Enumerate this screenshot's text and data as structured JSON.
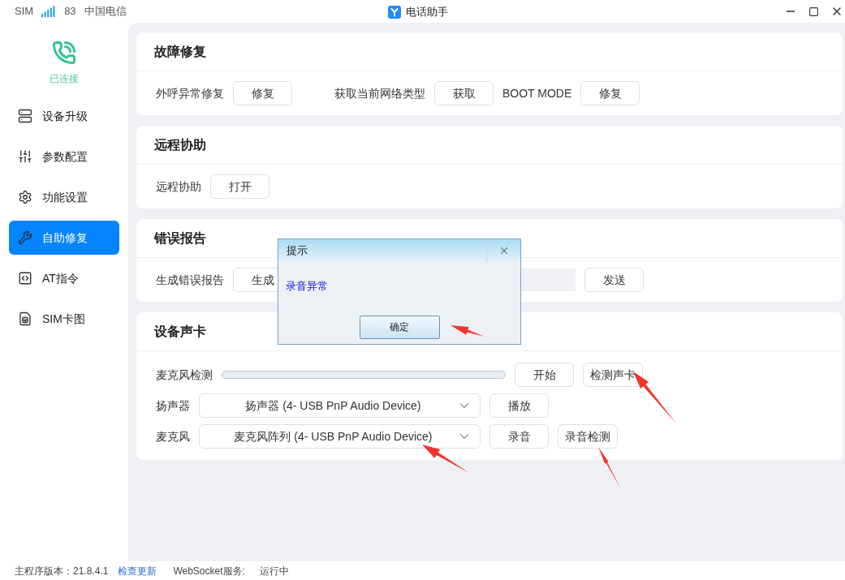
{
  "status": {
    "sim_label": "SIM",
    "signal_value": "83",
    "carrier": "中国电信"
  },
  "window": {
    "title": "电话助手"
  },
  "connection": {
    "label": "已连接"
  },
  "sidebar": {
    "items": [
      {
        "label": "设备升级",
        "selected": false
      },
      {
        "label": "参数配置",
        "selected": false
      },
      {
        "label": "功能设置",
        "selected": false
      },
      {
        "label": "自助修复",
        "selected": true
      },
      {
        "label": "AT指令",
        "selected": false
      },
      {
        "label": "SIM卡图",
        "selected": false
      }
    ]
  },
  "sections": [
    {
      "title": "故障修复",
      "rows": [
        [
          {
            "kind": "label",
            "text": "外呼异常修复"
          },
          {
            "kind": "button",
            "text": "修复"
          },
          {
            "kind": "gap"
          },
          {
            "kind": "label",
            "text": "获取当前网络类型"
          },
          {
            "kind": "button",
            "text": "获取"
          },
          {
            "kind": "label",
            "text": "BOOT MODE"
          },
          {
            "kind": "button",
            "text": "修复"
          }
        ]
      ]
    },
    {
      "title": "远程协助",
      "rows": [
        [
          {
            "kind": "label",
            "text": "远程协助"
          },
          {
            "kind": "button",
            "text": "打开"
          }
        ]
      ]
    },
    {
      "title": "错误报告",
      "rows": [
        [
          {
            "kind": "label",
            "text": "生成错误报告"
          },
          {
            "kind": "button",
            "text": "生成"
          },
          {
            "kind": "field"
          },
          {
            "kind": "button",
            "text": "发送"
          }
        ]
      ]
    },
    {
      "title": "设备声卡",
      "rows": [
        [
          {
            "kind": "label",
            "text": "麦克风检测"
          },
          {
            "kind": "progress",
            "level": 0
          },
          {
            "kind": "button",
            "text": "开始"
          },
          {
            "kind": "button",
            "text": "检测声卡"
          }
        ],
        [
          {
            "kind": "label",
            "text": "扬声器"
          },
          {
            "kind": "select",
            "value": "扬声器 (4- USB PnP Audio Device)"
          },
          {
            "kind": "button",
            "text": "播放"
          }
        ],
        [
          {
            "kind": "label",
            "text": "麦克风"
          },
          {
            "kind": "select",
            "value": "麦克风阵列 (4- USB PnP Audio Device)"
          },
          {
            "kind": "button",
            "text": "录音"
          },
          {
            "kind": "button",
            "text": "录音检测"
          }
        ]
      ]
    }
  ],
  "dialog": {
    "title": "提示",
    "message": "录音异常",
    "button": "确定"
  },
  "status_bar": {
    "version": "主程序版本：21.8.4.1",
    "update_link": "检查更新",
    "service_label": "WebSocket服务:",
    "service_state": "运行中"
  }
}
